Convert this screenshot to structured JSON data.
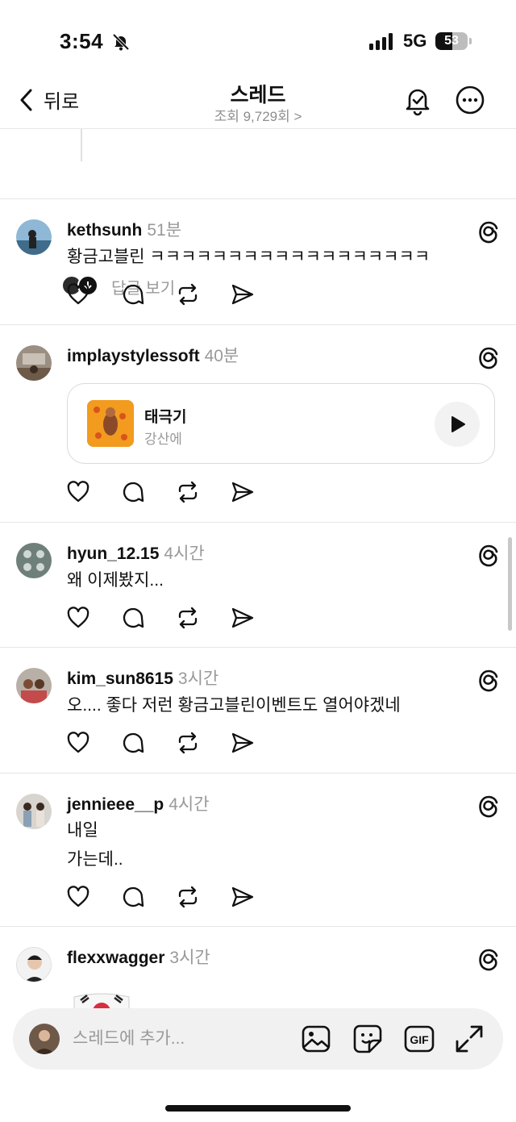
{
  "status": {
    "time": "3:54",
    "network": "5G",
    "battery": "53",
    "battery_level": 0.53
  },
  "header": {
    "back_label": "뒤로",
    "title": "스레드",
    "subtitle": "조회 9,729회 >"
  },
  "partial": {
    "view_replies": "답글 보기"
  },
  "posts": [
    {
      "username": "kethsunh",
      "time": "51분",
      "lines": [
        "황금고블린 ㅋㅋㅋㅋㅋㅋㅋㅋㅋㅋㅋㅋㅋㅋㅋㅋㅋㅋ"
      ]
    },
    {
      "username": "implaystylessoft",
      "time": "40분",
      "music": {
        "title": "태극기",
        "artist": "강산에"
      }
    },
    {
      "username": "hyun_12.15",
      "time": "4시간",
      "lines": [
        "왜 이제봤지..."
      ]
    },
    {
      "username": "kim_sun8615",
      "time": "3시간",
      "lines": [
        "오.... 좋다 저런 황금고블린이벤트도 열어야겠네"
      ]
    },
    {
      "username": "jennieee__p",
      "time": "4시간",
      "lines": [
        "내일",
        "가는데.."
      ]
    },
    {
      "username": "flexxwagger",
      "time": "3시간"
    }
  ],
  "composer": {
    "placeholder": "스레드에 추가...",
    "gif_label": "GIF"
  },
  "icons": [
    "back-chevron-icon",
    "notification-bell-icon",
    "more-icon",
    "threads-logo-icon",
    "heart-icon",
    "comment-icon",
    "repost-icon",
    "share-icon",
    "play-icon",
    "image-icon",
    "sticker-icon",
    "gif-icon",
    "expand-icon"
  ]
}
